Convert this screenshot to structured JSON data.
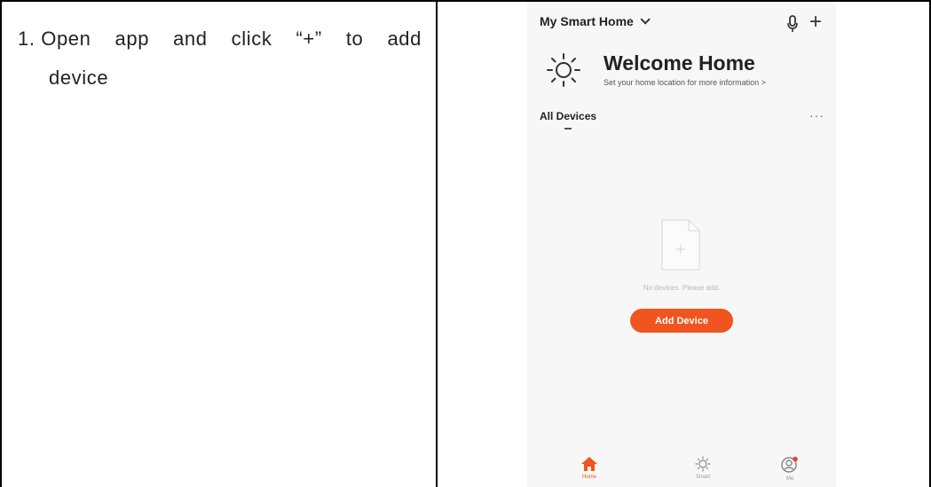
{
  "instruction": {
    "step_words": [
      "1. Open",
      "app",
      "and",
      "click",
      "“+”",
      "to",
      "add"
    ],
    "line2": "device"
  },
  "phone": {
    "home_selector": "My Smart Home",
    "welcome_title": "Welcome Home",
    "welcome_subtitle": "Set your home location for more information >",
    "all_devices": "All Devices",
    "more": "···",
    "plus": "+",
    "empty_text": "No devices. Please add.",
    "add_device_label": "Add Device",
    "tabs": [
      {
        "label": "Home"
      },
      {
        "label": "Smart"
      },
      {
        "label": "Me"
      }
    ],
    "colors": {
      "accent": "#f0551f",
      "background": "#f7f7f7"
    }
  }
}
